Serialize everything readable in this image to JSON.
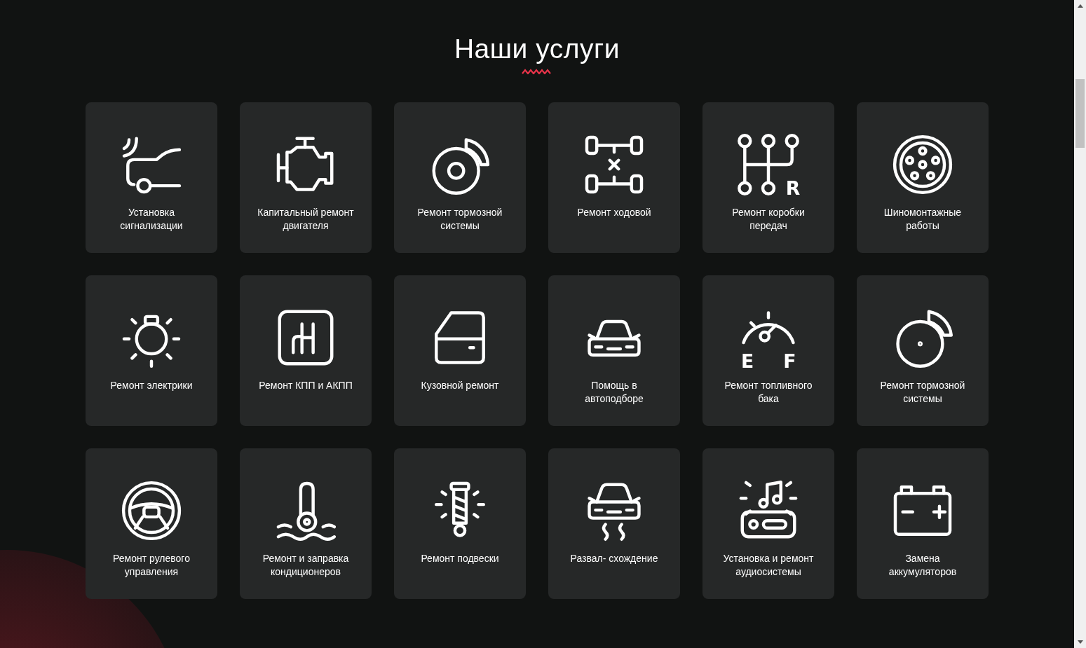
{
  "title": "Наши услуги",
  "services": [
    {
      "label": "Установка сигнализации"
    },
    {
      "label": "Капитальный ремонт двигателя"
    },
    {
      "label": "Ремонт тормозной системы"
    },
    {
      "label": "Ремонт ходовой"
    },
    {
      "label": "Ремонт коробки передач",
      "icon_text": [
        "R"
      ]
    },
    {
      "label": "Шиномонтажные работы"
    },
    {
      "label": "Ремонт электрики"
    },
    {
      "label": "Ремонт КПП и АКПП"
    },
    {
      "label": "Кузовной ремонт"
    },
    {
      "label": "Помощь в автоподборе"
    },
    {
      "label": "Ремонт топливного бака",
      "icon_text": [
        "E",
        "F"
      ]
    },
    {
      "label": "Ремонт тормозной системы"
    },
    {
      "label": "Ремонт рулевого управления"
    },
    {
      "label": "Ремонт и заправка кондиционеров"
    },
    {
      "label": "Ремонт подвески"
    },
    {
      "label": "Развал- схождение"
    },
    {
      "label": "Установка и ремонт аудиосистемы"
    },
    {
      "label": "Замена аккумуляторов"
    }
  ]
}
